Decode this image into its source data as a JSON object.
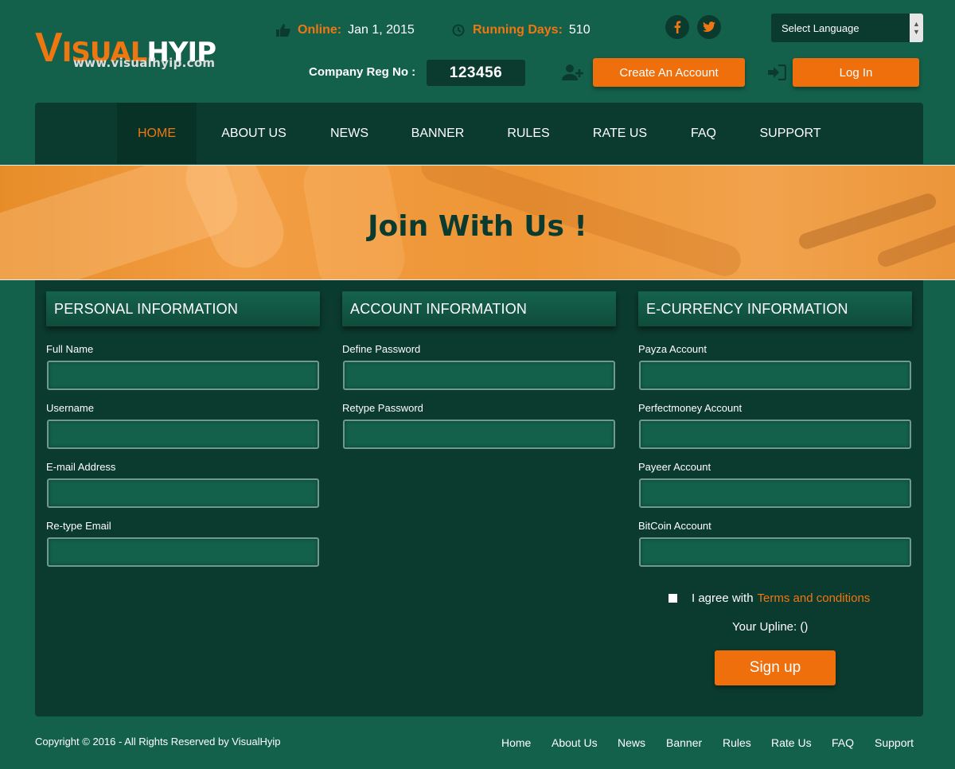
{
  "brand": {
    "logo_letter": "V",
    "logo_middle": "ISUAL",
    "logo_end": "HYIP",
    "url": "www.visualhyip.com"
  },
  "header": {
    "online_label": "Online:",
    "online_value": "Jan 1, 2015",
    "running_label": "Running Days:",
    "running_value": "510",
    "regno_label": "Company Reg No :",
    "regno_value": "123456",
    "language_select": "Select Language",
    "create_account": "Create An Account",
    "login": "Log In",
    "social": [
      "f",
      "twitter"
    ]
  },
  "nav": {
    "items": [
      "HOME",
      "ABOUT US",
      "NEWS",
      "BANNER",
      "RULES",
      "RATE US",
      "FAQ",
      "SUPPORT"
    ],
    "active": "HOME"
  },
  "banner": {
    "title": "Join With Us !"
  },
  "form": {
    "personal": {
      "heading": "PERSONAL INFORMATION",
      "fields": [
        "Full Name",
        "Username",
        "E-mail Address",
        "Re-type Email"
      ]
    },
    "account": {
      "heading": "ACCOUNT INFORMATION",
      "fields": [
        "Define Password",
        "Retype Password"
      ]
    },
    "ecurrency": {
      "heading": "E-CURRENCY INFORMATION",
      "fields": [
        "Payza Account",
        "Perfectmoney Account",
        "Payeer Account",
        "BitCoin Account"
      ]
    },
    "agree_text": "I agree with",
    "terms_link": "Terms and conditions",
    "upline": "Your Upline: ()",
    "signup": "Sign up"
  },
  "footer": {
    "copyright": "Copyright © 2016 - All Rights Reserved by VisualHyip",
    "links": [
      "Home",
      "About Us",
      "News",
      "Banner",
      "Rules",
      "Rate Us",
      "FAQ",
      "Support"
    ]
  },
  "colors": {
    "background": "#14614b",
    "panel": "#0b3a2e",
    "accent": "#ee7711",
    "button": "#ee6f0b"
  }
}
